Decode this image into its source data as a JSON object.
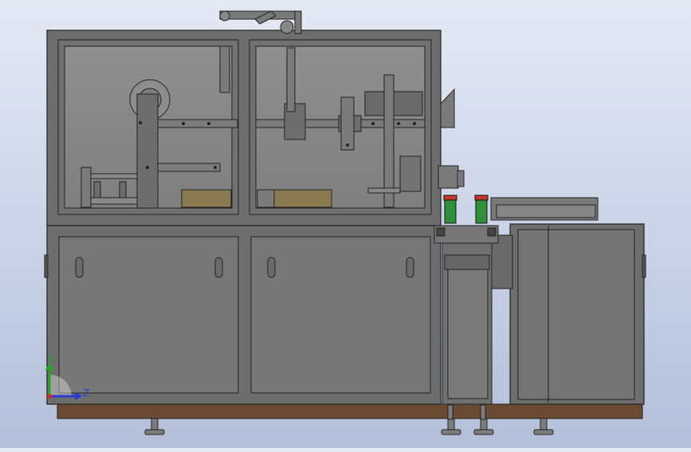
{
  "viewport": {
    "model": "packaging-machine-assembly",
    "view": "front",
    "background_top": "#e4e9f4",
    "background_bottom": "#b3bfd9"
  },
  "colors": {
    "frame": "#6e6e6e",
    "panel": "#777777",
    "panel_dark": "#5e5e5e",
    "glass": "#8b8b8b",
    "outline": "#222222",
    "base_wood": "#6b4a33",
    "cardboard": "#8a7a52",
    "green_part": "#2f8f3a",
    "red_part": "#c0392b"
  },
  "triad": {
    "y_label": "Y",
    "z_label": "Z",
    "y_color": "#1fa81f",
    "z_color": "#2a3bd6",
    "x_color": "#d62a2a"
  }
}
